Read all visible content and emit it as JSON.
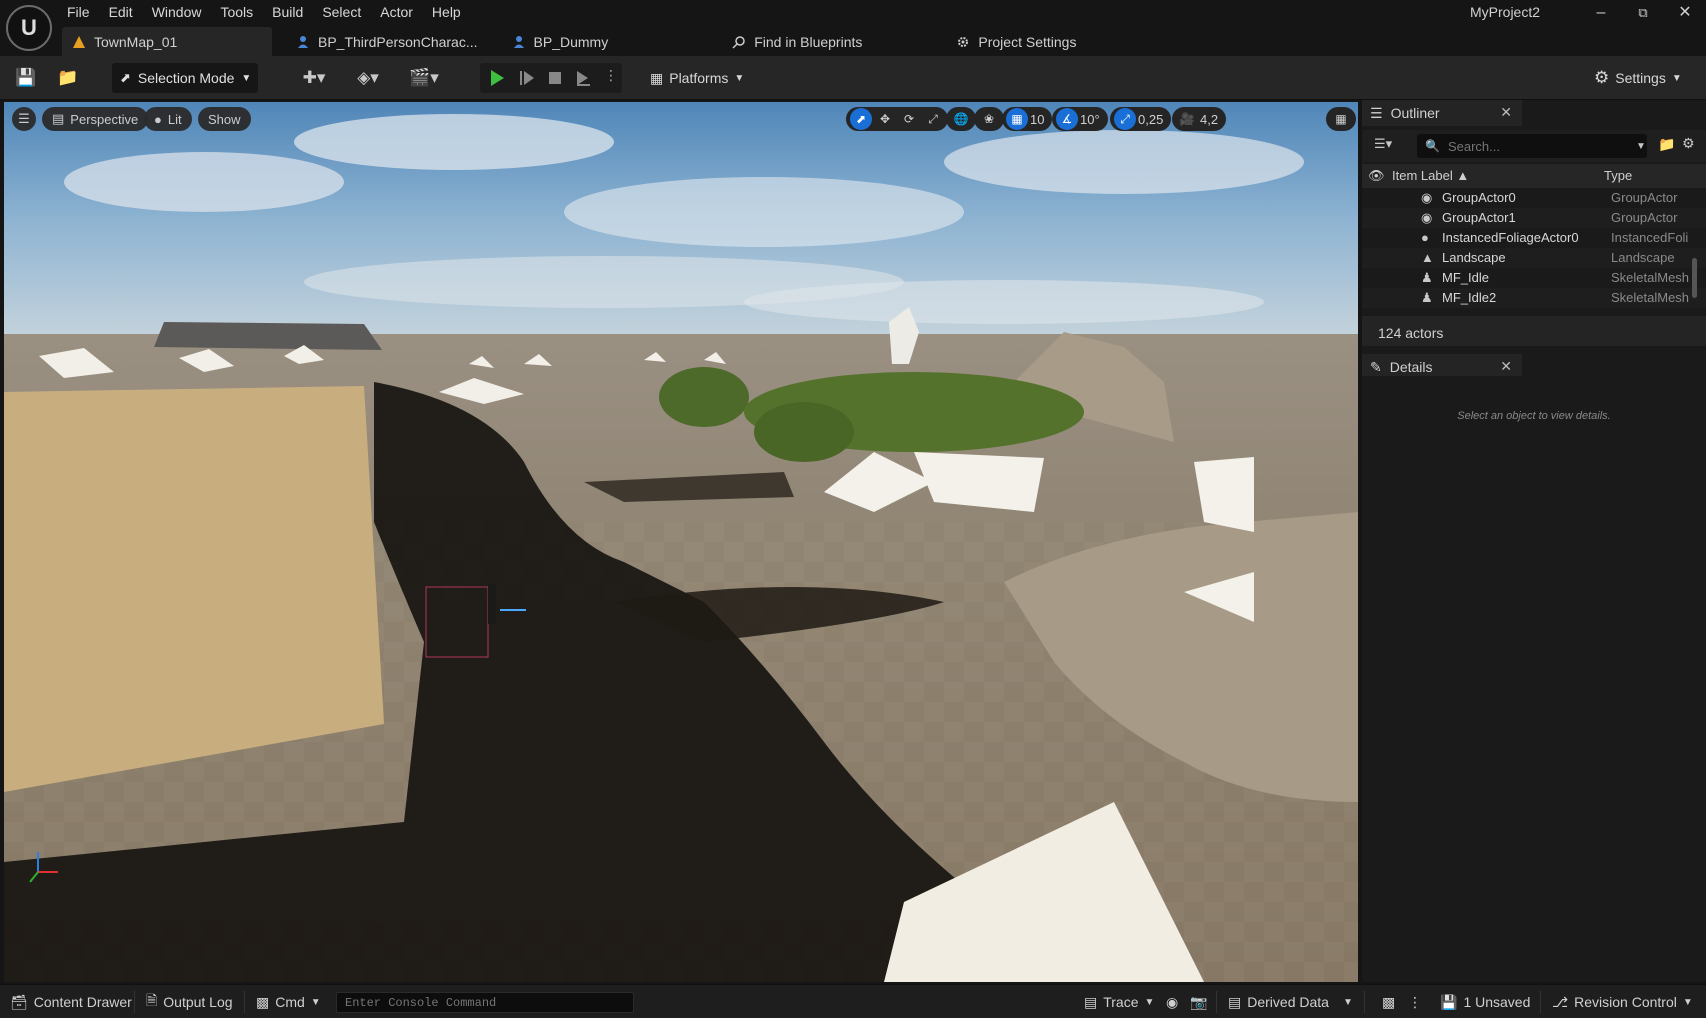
{
  "menu": [
    "File",
    "Edit",
    "Window",
    "Tools",
    "Build",
    "Select",
    "Actor",
    "Help"
  ],
  "project_name": "MyProject2",
  "tabs": [
    {
      "label": "TownMap_01",
      "icon": "level-icon",
      "active": true
    },
    {
      "label": "BP_ThirdPersonCharac...",
      "icon": "blueprint-person-icon",
      "active": false
    },
    {
      "label": "BP_Dummy",
      "icon": "blueprint-person-icon",
      "active": false
    },
    {
      "label": "Find in Blueprints",
      "icon": "find-icon",
      "active": false
    },
    {
      "label": "Project Settings",
      "icon": "settings-gear-icon",
      "active": false
    }
  ],
  "toolbar": {
    "selection_mode": "Selection Mode",
    "platforms": "Platforms",
    "settings": "Settings"
  },
  "viewport": {
    "perspective": "Perspective",
    "lit": "Lit",
    "show": "Show",
    "grid_snap": "10",
    "rotation_snap": "10°",
    "scale_snap": "0,25",
    "camera_speed": "4,2"
  },
  "outliner": {
    "title": "Outliner",
    "search_placeholder": "Search...",
    "col_label": "Item Label",
    "col_type": "Type",
    "rows": [
      {
        "label": "GroupActor0",
        "type": "GroupActor"
      },
      {
        "label": "GroupActor1",
        "type": "GroupActor"
      },
      {
        "label": "InstancedFoliageActor0",
        "type": "InstancedFoli"
      },
      {
        "label": "Landscape",
        "type": "Landscape"
      },
      {
        "label": "MF_Idle",
        "type": "SkeletalMesh"
      },
      {
        "label": "MF_Idle2",
        "type": "SkeletalMesh"
      }
    ],
    "actor_count": "124 actors"
  },
  "details": {
    "title": "Details",
    "empty": "Select an object to view details."
  },
  "statusbar": {
    "content_drawer": "Content Drawer",
    "output_log": "Output Log",
    "cmd": "Cmd",
    "console_placeholder": "Enter Console Command",
    "trace": "Trace",
    "derived_data": "Derived Data",
    "unsaved": "1 Unsaved",
    "revision_control": "Revision Control"
  },
  "colors": {
    "accent": "#1a6fd6",
    "play_green": "#3fbf3f"
  }
}
